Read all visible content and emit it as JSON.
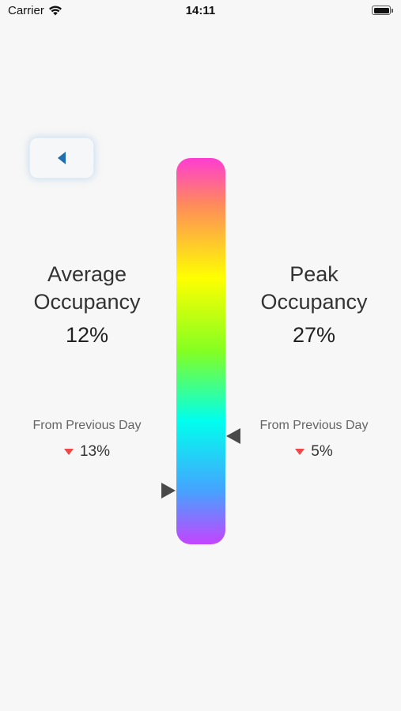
{
  "status_bar": {
    "carrier": "Carrier",
    "time": "14:11",
    "icons": [
      "wifi-icon",
      "battery-icon"
    ]
  },
  "back_button": {
    "icon": "caret-left-icon",
    "color": "#1f6fb0"
  },
  "average": {
    "title_line1": "Average",
    "title_line2": "Occupancy",
    "value": "12%",
    "change_caption": "From Previous Day",
    "change_value": "13%",
    "change_direction": "down",
    "marker_level": 0.86
  },
  "peak": {
    "title_line1": "Peak",
    "title_line2": "Occupancy",
    "value": "27%",
    "change_caption": "From Previous Day",
    "change_value": "5%",
    "change_direction": "down",
    "marker_level": 0.72
  },
  "colors": {
    "down_indicator": "#f04848",
    "marker": "#4a4a4a",
    "gradient_stops": [
      "#ff3dd2",
      "#ff8a5c",
      "#ffff00",
      "#84ff22",
      "#00ffee",
      "#44a4ff",
      "#c444ff"
    ]
  }
}
